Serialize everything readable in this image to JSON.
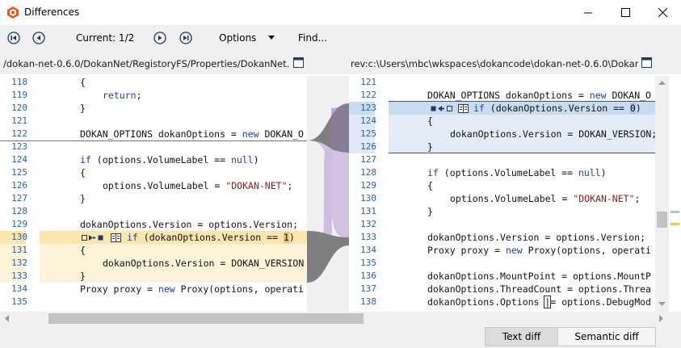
{
  "window": {
    "title": "Differences"
  },
  "toolbar": {
    "current": "Current: 1/2",
    "options": "Options",
    "find": "Find..."
  },
  "left": {
    "path": "/dokan-net-0.6.0/DokanNet/RegistoryFS/Properties/DokanNet.cs...",
    "lines": [
      "118",
      "119",
      "120",
      "121",
      "122",
      "123",
      "124",
      "125",
      "126",
      "127",
      "128",
      "129",
      "130",
      "131",
      "132",
      "133",
      "134",
      "135"
    ]
  },
  "right": {
    "path": "rev:c:\\Users\\mbc\\wkspaces\\dokancode\\dokan-net-0.6.0\\DokanN...",
    "lines": [
      "121",
      "122",
      "123",
      "124",
      "125",
      "126",
      "127",
      "128",
      "129",
      "130",
      "131",
      "132",
      "133",
      "134",
      "135",
      "136",
      "137",
      "138"
    ]
  },
  "code": {
    "l_open_brace": "{",
    "l_return": "return",
    "l_semicolon": ";",
    "l_close_brace": "}",
    "l_dokan_decl_pre": "DOKAN_OPTIONS dokanOptions = ",
    "new": "new",
    "l_dokan_decl_post": " DOKAN_O",
    "if": "if",
    "l_if_label": " (options.VolumeLabel == ",
    "null": "null",
    "close_paren": ")",
    "l_vol_assign": "options.VolumeLabel = ",
    "dokan_net_str": "\"DOKAN-NET\"",
    "l_version_assign": "dokanOptions.Version = options.Version;",
    "l_if_version": " (dokanOptions.Version == ",
    "l_if_one": "1",
    "l_version_dokan": "dokanOptions.Version = DOKAN_VERSION",
    "l_proxy_pre": "Proxy proxy = ",
    "l_proxy_post": " Proxy(options, operati",
    "r_dokan_decl_post": " DOKAN_O",
    "r_if_zero": "0",
    "r_version_dokan": "dokanOptions.Version = DOKAN_VERSION;",
    "r_version_assign": "dokanOptions.Version = options.Version;",
    "r_proxy_post": " Proxy(options, operati",
    "r_mount": "dokanOptions.MountPoint = options.MountP",
    "r_thread": "dokanOptions.ThreadCount = options.Threa",
    "r_options_pre": "dokanOptions.Options ",
    "r_options_pipe": "|",
    "r_options_post": "= options.DebugMod"
  },
  "bottom": {
    "text_diff": "Text diff",
    "semantic_diff": "Semantic diff"
  },
  "colors": {
    "accent": "#e85a1b",
    "diff_blue": "#d8e6f4",
    "diff_yellow": "#fdf0cc",
    "connector": "#cdbde0"
  }
}
